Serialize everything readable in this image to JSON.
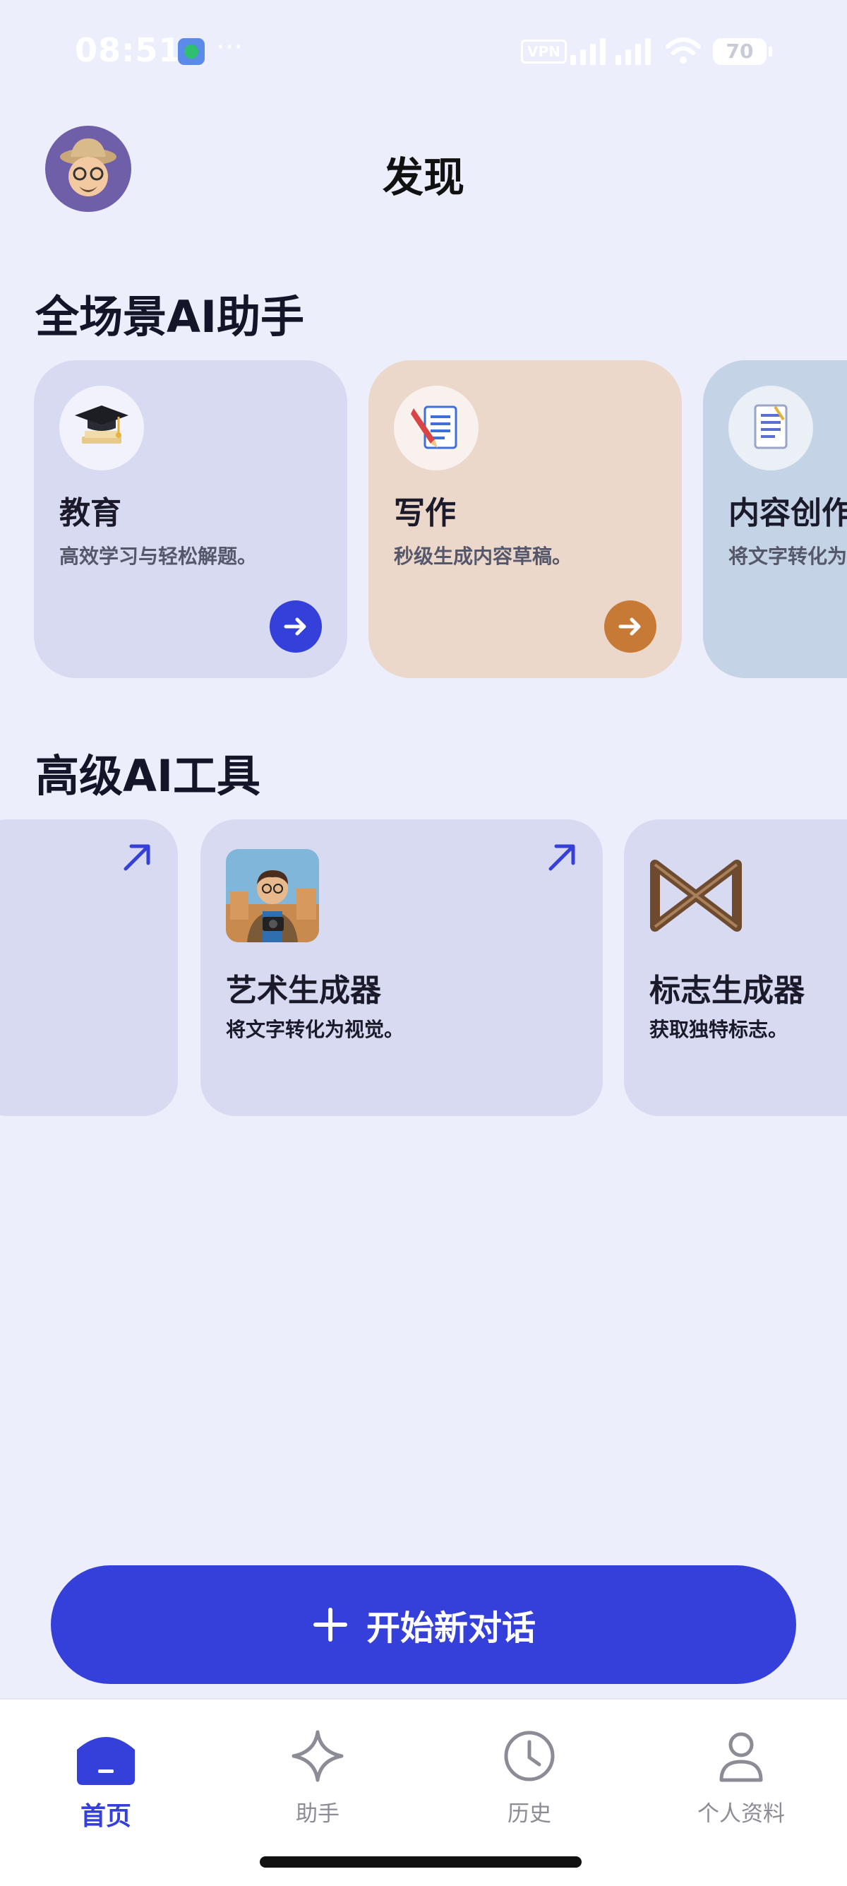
{
  "status_bar": {
    "time": "08:51",
    "dots": "···",
    "vpn": "VPN",
    "battery": "70"
  },
  "header": {
    "title": "发现"
  },
  "assistants": {
    "section_title": "全场景AI助手",
    "cards": [
      {
        "title": "教育",
        "desc": "高效学习与轻松解题。",
        "bg": "#D8DAF2",
        "arrow_color": "#3540DA"
      },
      {
        "title": "写作",
        "desc": "秒级生成内容草稿。",
        "bg": "#ECD8CA",
        "arrow_color": "#C77A36"
      },
      {
        "title": "内容创作",
        "desc": "将文字转化为",
        "bg": "#C5D3E6"
      }
    ]
  },
  "tools": {
    "section_title": "高级AI工具",
    "cards": [
      {
        "title": "艺术生成器",
        "desc": "将文字转化为视觉。"
      },
      {
        "title": "标志生成器",
        "desc": "获取独特标志。"
      }
    ]
  },
  "cta": {
    "label": "开始新对话"
  },
  "tabbar": {
    "items": [
      {
        "label": "首页",
        "icon": "home-icon",
        "active": true
      },
      {
        "label": "助手",
        "icon": "sparkle-icon"
      },
      {
        "label": "历史",
        "icon": "clock-icon"
      },
      {
        "label": "个人资料",
        "icon": "profile-icon"
      }
    ]
  },
  "colors": {
    "accent": "#3540DA",
    "background": "#ECEEFC"
  }
}
